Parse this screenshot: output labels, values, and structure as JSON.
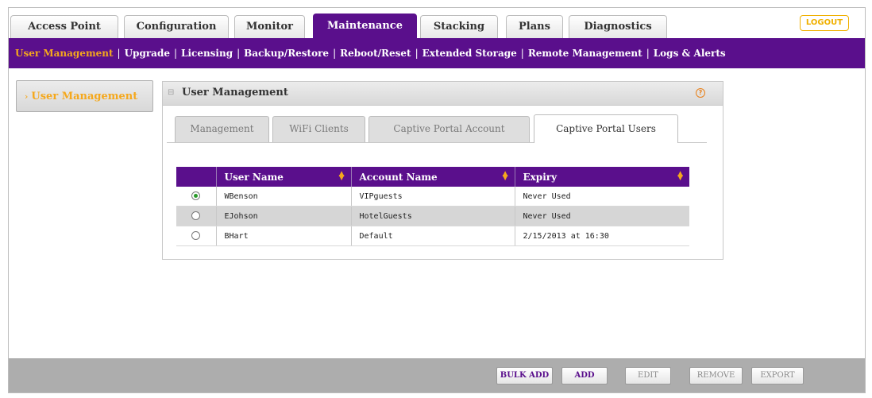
{
  "top_tabs": [
    {
      "label": "Access Point"
    },
    {
      "label": "Configuration"
    },
    {
      "label": "Monitor"
    },
    {
      "label": "Maintenance",
      "active": true
    },
    {
      "label": "Stacking"
    },
    {
      "label": "Plans"
    },
    {
      "label": "Diagnostics"
    }
  ],
  "logout_label": "LOGOUT",
  "subnav": [
    {
      "label": "User Management",
      "active": true
    },
    {
      "label": "Upgrade"
    },
    {
      "label": "Licensing"
    },
    {
      "label": "Backup/Restore"
    },
    {
      "label": "Reboot/Reset"
    },
    {
      "label": "Extended Storage"
    },
    {
      "label": "Remote Management"
    },
    {
      "label": "Logs & Alerts"
    }
  ],
  "sidebar": {
    "items": [
      {
        "label": "User Management",
        "active": true
      }
    ]
  },
  "panel": {
    "title": "User Management",
    "help_glyph": "?"
  },
  "inner_tabs": [
    {
      "label": "Management"
    },
    {
      "label": "WiFi Clients"
    },
    {
      "label": "Captive Portal Account"
    },
    {
      "label": "Captive Portal Users",
      "active": true
    }
  ],
  "table": {
    "columns": [
      "User Name",
      "Account Name",
      "Expiry"
    ],
    "rows": [
      {
        "selected": true,
        "user_name": "WBenson",
        "account_name": "VIPguests",
        "expiry": "Never Used"
      },
      {
        "selected": false,
        "user_name": "EJohson",
        "account_name": "HotelGuests",
        "expiry": "Never Used"
      },
      {
        "selected": false,
        "user_name": "BHart",
        "account_name": "Default",
        "expiry": "2/15/2013 at 16:30"
      }
    ]
  },
  "buttons": {
    "bulk_add": "BULK ADD",
    "add": "ADD",
    "edit": "EDIT",
    "remove": "REMOVE",
    "export": "EXPORT"
  },
  "colors": {
    "brand_purple": "#5a0f8c",
    "accent_orange": "#f5a81c",
    "logout_yellow": "#f0b000"
  },
  "icons": {
    "sort": "sort-icon",
    "help": "help-icon",
    "radio": "radio-icon",
    "chevron": "chevron-right-icon"
  }
}
